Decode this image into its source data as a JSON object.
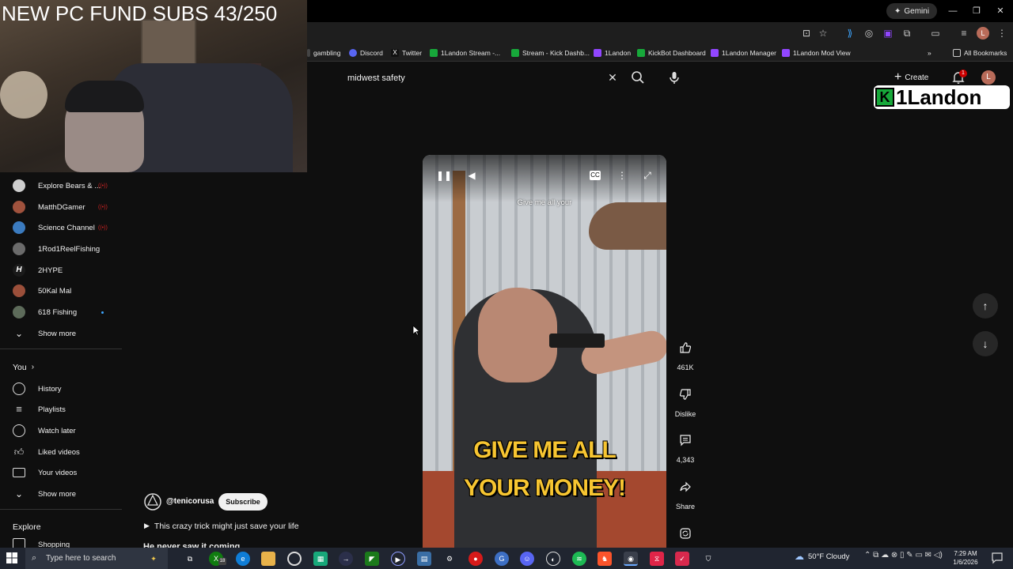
{
  "overlay": {
    "subs_text": "NEW PC FUND SUBS 43/250",
    "logo_text": "1Landon",
    "logo_k": "K"
  },
  "window": {
    "gemini_label": "Gemini"
  },
  "bookmarks": [
    {
      "label": "gambling",
      "color": "#444"
    },
    {
      "label": "Discord",
      "color": "#5865f2"
    },
    {
      "label": "Twitter",
      "color": "#111"
    },
    {
      "label": "1Landon Stream -...",
      "color": "#17a83a"
    },
    {
      "label": "Stream - Kick Dashb...",
      "color": "#17a83a"
    },
    {
      "label": "1Landon",
      "color": "#9146ff"
    },
    {
      "label": "KickBot Dashboard",
      "color": "#17a83a"
    },
    {
      "label": "1Landon Manager",
      "color": "#9146ff"
    },
    {
      "label": "1Landon Mod View",
      "color": "#9146ff"
    }
  ],
  "all_bookmarks_label": "All Bookmarks",
  "search": {
    "value": "midwest safety"
  },
  "header": {
    "create_label": "Create",
    "notification_count": "1",
    "avatar_letter": "L"
  },
  "sidebar": {
    "subscriptions": [
      {
        "label": "Explore Bears & ...",
        "live": true,
        "color": "#cfcfcf"
      },
      {
        "label": "MatthDGamer",
        "live": true,
        "color": "#a0523d"
      },
      {
        "label": "Science Channel",
        "live": true,
        "color": "#3b7bbf"
      },
      {
        "label": "1Rod1ReelFishing",
        "live": false,
        "color": "#6b6b6b"
      },
      {
        "label": "2HYPE",
        "live": false,
        "color": "#1a1a1a"
      },
      {
        "label": "50Kal Mal",
        "live": false,
        "color": "#9b4f3a"
      },
      {
        "label": "618 Fishing",
        "live": false,
        "dot": true,
        "color": "#5d6b5a"
      }
    ],
    "show_more_1": "Show more",
    "you_label": "You",
    "you_items": [
      {
        "label": "History",
        "icon": "history-icon"
      },
      {
        "label": "Playlists",
        "icon": "playlists-icon"
      },
      {
        "label": "Watch later",
        "icon": "watch-later-icon"
      },
      {
        "label": "Liked videos",
        "icon": "liked-videos-icon"
      },
      {
        "label": "Your videos",
        "icon": "your-videos-icon"
      }
    ],
    "show_more_2": "Show more",
    "explore_label": "Explore",
    "shopping_label": "Shopping"
  },
  "video": {
    "caption_top": "Give me all your",
    "caption_line1": "GIVE ME ALL",
    "caption_line2": "YOUR MONEY!"
  },
  "actions": {
    "likes": "461K",
    "dislike_label": "Dislike",
    "comments": "4,343",
    "share_label": "Share"
  },
  "channel": {
    "handle": "@tenicorusa",
    "subscribe_label": "Subscribe",
    "title": "This crazy trick might just save your life",
    "next_title": "He never saw it coming"
  },
  "taskbar": {
    "search_placeholder": "Type here to search",
    "weather": "50°F  Cloudy",
    "time": "7:29 AM",
    "date": "1/6/2026",
    "xbox_badge": "18"
  }
}
